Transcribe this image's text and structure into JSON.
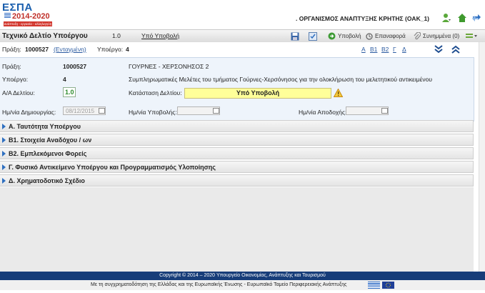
{
  "header": {
    "logo_text": "ΕΣΠΑ",
    "logo_years": "2014-2020",
    "logo_slogan": "ανάπτυξη - εργασία - αλληλεγγύη",
    "org_name": ". ΟΡΓΑΝΙΣΜΟΣ ΑΝΑΠΤΥΞΗΣ ΚΡΗΤΗΣ (OAK_1)",
    "icons": [
      "user-icon",
      "home-icon",
      "switch-icon"
    ]
  },
  "toolbar": {
    "title": "Τεχνικό Δελτίο Υποέργου",
    "version": "1.0",
    "status_link": "Υπό Υποβολή",
    "submit_label": "Υποβολή",
    "restore_label": "Επαναφορά",
    "attachments_label": "Συνημμένα (0)"
  },
  "crumb": {
    "praxi_label": "Πράξη:",
    "praxi_value": "1000527",
    "praxi_status": "(Ενταγμένη)",
    "ypoergo_label": "Υποέργο:",
    "ypoergo_value": "4",
    "nav_links": [
      "Α",
      "Β1",
      "Β2",
      "Γ",
      "Δ"
    ]
  },
  "panel": {
    "praxi_label": "Πράξη:",
    "praxi_code": "1000527",
    "praxi_title": "ΓΟΥΡΝΕΣ - ΧΕΡΣΟΝΗΣΟΣ 2",
    "ypoergo_label": "Υποέργο:",
    "ypoergo_code": "4",
    "ypoergo_title": "Συμπληρωματικές Μελέτες του τμήματος Γούρνες-Χερσόνησος για την ολοκλήρωση του μελετητικού αντικειμένου",
    "aa_label": "Α/Α Δελτίου:",
    "aa_value": "1.0",
    "katastasi_label": "Κατάσταση Δελτίου:",
    "katastasi_value": "Υπό Υποβολή",
    "date_created_label": "Ημ/νία Δημιουργίας:",
    "date_created_value": "08/12/2015",
    "date_submit_label": "Ημ/νία Υποβολής:",
    "date_submit_value": "",
    "date_accept_label": "Ημ/νία Αποδοχής:",
    "date_accept_value": ""
  },
  "sections": [
    "Α. Ταυτότητα Υποέργου",
    "Β1. Στοιχεία Αναδόχου / ων",
    "Β2. Εμπλεκόμενοι Φορείς",
    "Γ. Φυσικό Αντικείμενο Υποέργου και Προγραμματισμός Υλοποίησης",
    "Δ. Χρηματοδοτικό Σχέδιο"
  ],
  "footer": {
    "copyright": "Copyright © 2014 – 2020 Υπουργείο Οικονομίας, Ανάπτυξης και Τουρισμού",
    "funding": "Με τη συγχρηματοδότηση της Ελλάδας και της Ευρωπαϊκής Ένωσης - Ευρωπαϊκό Ταμείο Περιφερειακής Ανάπτυξης"
  },
  "colors": {
    "footer_bg": "#173d79",
    "status_bg": "#ffff99",
    "panel_bg": "#eef4fb",
    "accent": "#2e6fc0"
  }
}
